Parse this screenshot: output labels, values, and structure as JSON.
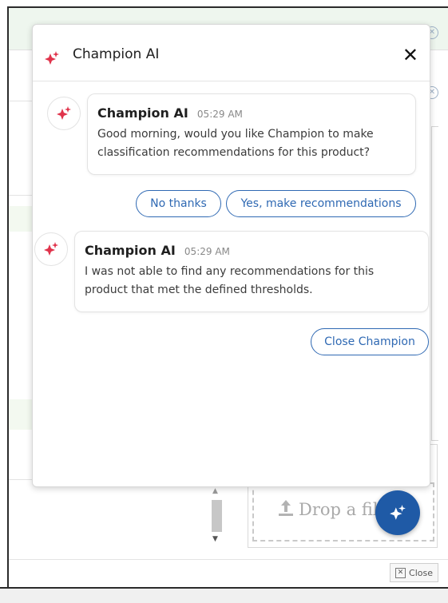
{
  "chat": {
    "title": "Champion AI",
    "messages": [
      {
        "sender": "Champion AI",
        "time": "05:29 AM",
        "body": "Good morning, would you like Champion to make classification recommendations for this product?"
      },
      {
        "sender": "Champion AI",
        "time": "05:29 AM",
        "body": "I was not able to find any recommendations for this product that met the defined thresholds."
      }
    ],
    "quick_replies": [
      "No thanks",
      "Yes, make recommendations"
    ],
    "close_champion_label": "Close Champion"
  },
  "drop_zone": {
    "text": "Drop a file here"
  },
  "footer": {
    "close_label": "Close"
  },
  "colors": {
    "accent": "#2f69b3",
    "fab": "#1f5aa6",
    "spark": "#e0334b"
  },
  "icons": [
    "sparkle-icon",
    "close-icon",
    "upload-icon",
    "dismiss-icon"
  ]
}
